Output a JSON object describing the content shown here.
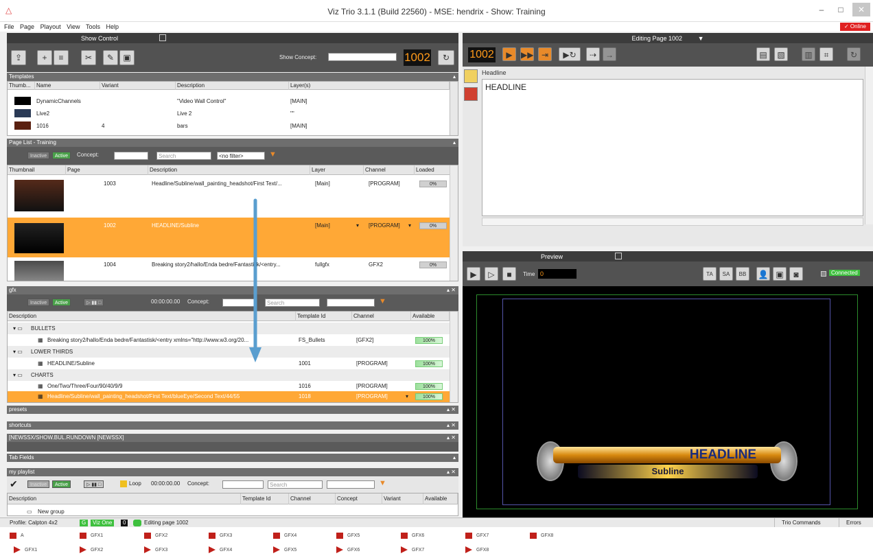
{
  "window": {
    "title": "Viz Trio 3.1.1 (Build 22560) - MSE: hendrix - Show: Training",
    "online": "✓ Online"
  },
  "menu": [
    "File",
    "Page",
    "Playout",
    "View",
    "Tools",
    "Help"
  ],
  "show_control": {
    "header": "Show Control",
    "concept_label": "Show Concept:",
    "page_number": "1002"
  },
  "templates": {
    "title": "Templates",
    "columns": [
      "Thumb...",
      "Name",
      "Variant",
      "Description",
      "Layer(s)"
    ],
    "rows": [
      {
        "name": "DynamicChannels",
        "variant": "",
        "description": "\"Video Wall Control\"",
        "layer": "[MAIN]"
      },
      {
        "name": "Live2",
        "variant": "",
        "description": "Live 2",
        "layer": "\"\""
      },
      {
        "name": "1016",
        "variant": "4",
        "description": "bars",
        "layer": "[MAIN]"
      }
    ]
  },
  "page_list": {
    "title": "Page List - Training",
    "inactive": "Inactive",
    "active": "Active",
    "concept": "Concept:",
    "search": "Search",
    "filter": "<no filter>",
    "columns": [
      "Thumbnail",
      "Page",
      "Description",
      "Layer",
      "Channel",
      "Loaded"
    ],
    "rows": [
      {
        "page": "1003",
        "description": "Headline/Subline/wall_painting_headshot/First Text/...",
        "layer": "[Main]",
        "channel": "[PROGRAM]",
        "loaded": "0%"
      },
      {
        "page": "1002",
        "description": "HEADLINE/Subline",
        "layer": "[Main]",
        "channel": "[PROGRAM]",
        "loaded": "0%"
      },
      {
        "page": "1004",
        "description": "Breaking story2/hallo/Enda bedre/Fantastisk/<entry...",
        "layer": "fullgfx",
        "channel": "GFX2",
        "loaded": "0%"
      }
    ]
  },
  "gfx": {
    "title": "gfx",
    "time": "00:00:00.00",
    "concept": "Concept:",
    "search": "Search",
    "columns": [
      "Description",
      "Template Id",
      "Channel",
      "Available"
    ],
    "groups": [
      {
        "name": "BULLETS",
        "items": [
          {
            "description": "Breaking story2/hallo/Enda bedre/Fantastisk/<entry xmlns=\"http://www.w3.org/20...",
            "template": "FS_Bullets",
            "channel": "[GFX2]",
            "available": "100%"
          }
        ]
      },
      {
        "name": "LOWER THIRDS",
        "items": [
          {
            "description": "HEADLINE/Subline",
            "template": "1001",
            "channel": "[PROGRAM]",
            "available": "100%"
          }
        ]
      },
      {
        "name": "CHARTS",
        "items": [
          {
            "description": "One/Two/Three/Four/90/40/9/9",
            "template": "1016",
            "channel": "[PROGRAM]",
            "available": "100%"
          },
          {
            "description": "Headline/Subline/wall_painting_headshot/First Text/blueEye/Second Text/44/55",
            "template": "1018",
            "channel": "[PROGRAM]",
            "available": "100%"
          }
        ]
      }
    ]
  },
  "sections": {
    "presets": "presets",
    "shortcuts": "shortcuts",
    "newssx": "[NEWSSX/SHOW.BUL.RUNDOWN [NEWSSX]",
    "tab_fields": "Tab Fields"
  },
  "playlist": {
    "title": "my playlist",
    "loop": "Loop",
    "time": "00:00:00.00",
    "concept": "Concept:",
    "search": "Search",
    "columns": [
      "Description",
      "Template Id",
      "Channel",
      "Concept",
      "Variant",
      "Available"
    ],
    "new_group": "New group"
  },
  "editor": {
    "header": "Editing Page 1002",
    "page_number": "1002",
    "field_label": "Headline",
    "field_value": "HEADLINE"
  },
  "preview": {
    "header": "Preview",
    "time_label": "Time",
    "time_value": "0",
    "buttons": [
      "TA",
      "SA",
      "BB"
    ],
    "connected": "Connected",
    "headline": "HEADLINE",
    "subline": "Subline"
  },
  "status": {
    "profile": "Profile: Calpton 4x2",
    "g": "G",
    "viz_one": "Viz One",
    "zero": "0",
    "editing": "Editing page 1002",
    "trio_commands": "Trio Commands",
    "errors": "Errors"
  },
  "channels_row1": [
    "A",
    "GFX1",
    "GFX2",
    "GFX3",
    "GFX4",
    "GFX5",
    "GFX6",
    "GFX7",
    "GFX8"
  ],
  "channels_row2": [
    "GFX1",
    "GFX2",
    "GFX3",
    "GFX4",
    "GFX5",
    "GFX6",
    "GFX7",
    "GFX8"
  ],
  "colors": {
    "accent_orange": "#ffa836",
    "online_red": "#e02020",
    "green": "#3ec03e",
    "arrow_blue": "#5a9ecf"
  }
}
